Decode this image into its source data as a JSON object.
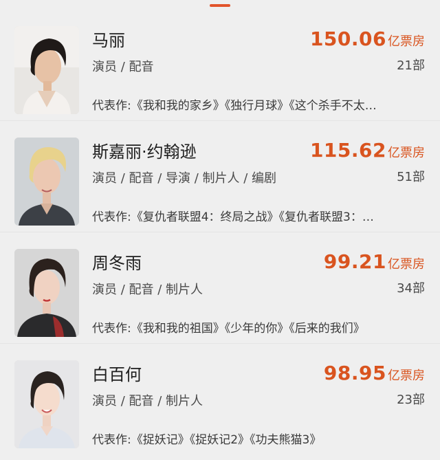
{
  "colors": {
    "accent": "#d9541f",
    "background": "#efefef"
  },
  "actors": [
    {
      "name": "马丽",
      "roles": "演员 / 配音",
      "box_office": "150.06",
      "box_office_unit": "亿票房",
      "works_count": "21部",
      "works_prefix": "代表作:",
      "works": "《我和我的家乡》《独行月球》《这个杀手不太…"
    },
    {
      "name": "斯嘉丽·约翰逊",
      "roles": "演员 / 配音 / 导演 / 制片人 / 编剧",
      "box_office": "115.62",
      "box_office_unit": "亿票房",
      "works_count": "51部",
      "works_prefix": "代表作:",
      "works": "《复仇者联盟4：终局之战》《复仇者联盟3：…"
    },
    {
      "name": "周冬雨",
      "roles": "演员 / 配音 / 制片人",
      "box_office": "99.21",
      "box_office_unit": "亿票房",
      "works_count": "34部",
      "works_prefix": "代表作:",
      "works": "《我和我的祖国》《少年的你》《后来的我们》"
    },
    {
      "name": "白百何",
      "roles": "演员 / 配音 / 制片人",
      "box_office": "98.95",
      "box_office_unit": "亿票房",
      "works_count": "23部",
      "works_prefix": "代表作:",
      "works": "《捉妖记》《捉妖记2》《功夫熊猫3》"
    }
  ]
}
